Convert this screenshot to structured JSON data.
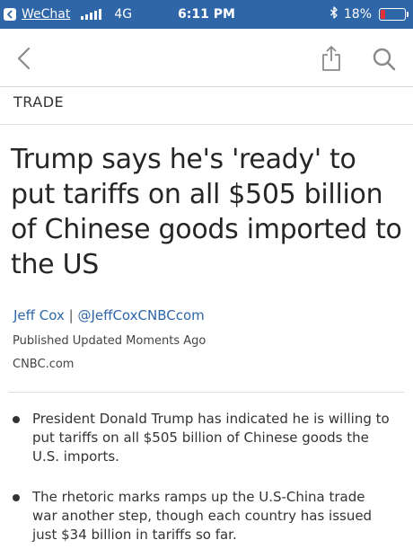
{
  "status_bar": {
    "back_app": "WeChat",
    "network": "4G",
    "time": "6:11 PM",
    "battery": "18%",
    "battery_level": 0.18,
    "battery_color": "#e3303b",
    "bar_color": "#2e66a8"
  },
  "nav": {
    "back_icon": "chevron-left-icon",
    "share_icon": "share-icon",
    "search_icon": "search-icon"
  },
  "article": {
    "section": "TRADE",
    "headline": "Trump says he's 'ready' to put tariffs on all $505 billion of Chinese goods imported to the US",
    "author": "Jeff Cox",
    "author_separator": "|",
    "author_handle": "@JeffCoxCNBCcom",
    "published": "Published Updated Moments Ago",
    "source": "CNBC.com",
    "bullets": [
      "President Donald Trump has indicated he is willing to put tariffs on all $505 billion of Chinese goods the U.S. imports.",
      "The rhetoric marks ramps up the U.S-China trade war another step, though each country has issued just $34 billion in tariffs so far."
    ]
  }
}
